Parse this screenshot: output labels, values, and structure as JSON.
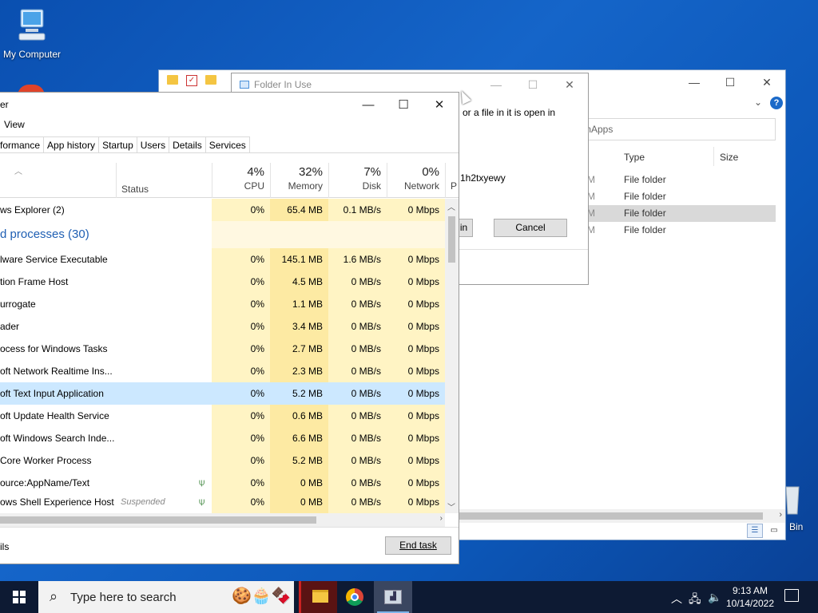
{
  "desktop": {
    "icons": [
      {
        "label": "My Computer",
        "icon": "computer-icon"
      },
      {
        "label": "Bin",
        "icon": "recycle-bin-icon"
      }
    ]
  },
  "explorer": {
    "address_text": "mApps",
    "columns": {
      "type": "Type",
      "size": "Size"
    },
    "rows": [
      {
        "mod": "M",
        "type": "File folder",
        "selected": false
      },
      {
        "mod": "M",
        "type": "File folder",
        "selected": false
      },
      {
        "mod": "M",
        "type": "File folder",
        "selected": true
      },
      {
        "mod": "M",
        "type": "File folder",
        "selected": false
      }
    ],
    "help": "?"
  },
  "dialog": {
    "title": "Folder In Use",
    "message": "or a file in it is open in",
    "item_name": "1h2txyewy",
    "retry_label": "in",
    "cancel_label": "Cancel"
  },
  "taskmanager": {
    "title": "er",
    "menu": {
      "view": "View"
    },
    "tabs": [
      "formance",
      "App history",
      "Startup",
      "Users",
      "Details",
      "Services"
    ],
    "header": {
      "status": "Status",
      "cpu": {
        "pct": "4%",
        "label": "CPU"
      },
      "memory": {
        "pct": "32%",
        "label": "Memory"
      },
      "disk": {
        "pct": "7%",
        "label": "Disk"
      },
      "network": {
        "pct": "0%",
        "label": "Network"
      },
      "power": "P"
    },
    "apps_rows": [
      {
        "name": "ws Explorer (2)",
        "status": "",
        "cpu": "0%",
        "memory": "65.4 MB",
        "disk": "0.1 MB/s",
        "network": "0 Mbps"
      }
    ],
    "group_label": "d processes (30)",
    "bg_rows": [
      {
        "name": "lware Service Executable",
        "status": "",
        "cpu": "0%",
        "memory": "145.1 MB",
        "disk": "1.6 MB/s",
        "network": "0 Mbps",
        "leaf": false,
        "selected": false
      },
      {
        "name": "tion Frame Host",
        "status": "",
        "cpu": "0%",
        "memory": "4.5 MB",
        "disk": "0 MB/s",
        "network": "0 Mbps",
        "leaf": false,
        "selected": false
      },
      {
        "name": "urrogate",
        "status": "",
        "cpu": "0%",
        "memory": "1.1 MB",
        "disk": "0 MB/s",
        "network": "0 Mbps",
        "leaf": false,
        "selected": false
      },
      {
        "name": "ader",
        "status": "",
        "cpu": "0%",
        "memory": "3.4 MB",
        "disk": "0 MB/s",
        "network": "0 Mbps",
        "leaf": false,
        "selected": false
      },
      {
        "name": "ocess for Windows Tasks",
        "status": "",
        "cpu": "0%",
        "memory": "2.7 MB",
        "disk": "0 MB/s",
        "network": "0 Mbps",
        "leaf": false,
        "selected": false
      },
      {
        "name": "oft Network Realtime Ins...",
        "status": "",
        "cpu": "0%",
        "memory": "2.3 MB",
        "disk": "0 MB/s",
        "network": "0 Mbps",
        "leaf": false,
        "selected": false
      },
      {
        "name": "oft Text Input Application",
        "status": "",
        "cpu": "0%",
        "memory": "5.2 MB",
        "disk": "0 MB/s",
        "network": "0 Mbps",
        "leaf": false,
        "selected": true
      },
      {
        "name": "oft Update Health Service",
        "status": "",
        "cpu": "0%",
        "memory": "0.6 MB",
        "disk": "0 MB/s",
        "network": "0 Mbps",
        "leaf": false,
        "selected": false
      },
      {
        "name": "oft Windows Search Inde...",
        "status": "",
        "cpu": "0%",
        "memory": "6.6 MB",
        "disk": "0 MB/s",
        "network": "0 Mbps",
        "leaf": false,
        "selected": false
      },
      {
        "name": "Core Worker Process",
        "status": "",
        "cpu": "0%",
        "memory": "5.2 MB",
        "disk": "0 MB/s",
        "network": "0 Mbps",
        "leaf": false,
        "selected": false
      },
      {
        "name": "ource:AppName/Text",
        "status": "",
        "cpu": "0%",
        "memory": "0 MB",
        "disk": "0 MB/s",
        "network": "0 Mbps",
        "leaf": true,
        "selected": false
      },
      {
        "name": "ows Shell Experience Host",
        "status": "Suspended",
        "cpu": "0%",
        "memory": "0 MB",
        "disk": "0 MB/s",
        "network": "0 Mbps",
        "leaf": true,
        "selected": false
      }
    ],
    "fewer_details": "ils",
    "end_task": "End task"
  },
  "taskbar": {
    "search_placeholder": "Type here to search",
    "apps": [
      {
        "name": "file-explorer",
        "active": false
      },
      {
        "name": "chrome",
        "active": false
      },
      {
        "name": "task-manager",
        "active": true
      }
    ],
    "clock": {
      "time": "9:13 AM",
      "date": "10/14/2022"
    }
  },
  "colors": {
    "desktop": "#1565c9",
    "heat_light": "#fff4c4",
    "heat_memory": "#fdeaa3",
    "selection": "#cce8ff",
    "group_text": "#1f5fb3",
    "taskbar": "#0d1a33"
  }
}
